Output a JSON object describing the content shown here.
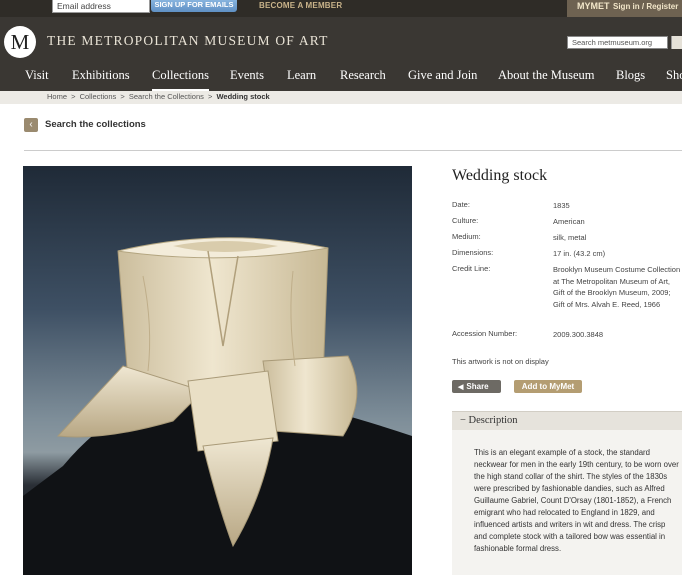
{
  "topbar": {
    "email_placeholder": "Email address",
    "signup_label": "SIGN UP FOR EMAILS",
    "become_member": "BECOME A MEMBER",
    "mymet": "MYMET",
    "signin": "Sign in / Register"
  },
  "header": {
    "logo_letter": "M",
    "title": "THE METROPOLITAN MUSEUM OF ART",
    "search_placeholder": "Search metmuseum.org",
    "nav": [
      "Visit",
      "Exhibitions",
      "Collections",
      "Events",
      "Learn",
      "Research",
      "Give and Join",
      "About the Museum",
      "Blogs",
      "Sho"
    ]
  },
  "breadcrumb": [
    "Home",
    "Collections",
    "Search the Collections",
    "Wedding stock"
  ],
  "back_link": "Search the collections",
  "object": {
    "title": "Wedding stock",
    "fields": [
      {
        "label": "Date:",
        "value": "1835"
      },
      {
        "label": "Culture:",
        "value": "American"
      },
      {
        "label": "Medium:",
        "value": "silk, metal"
      },
      {
        "label": "Dimensions:",
        "value": "17 in. (43.2 cm)"
      },
      {
        "label": "Credit Line:",
        "value": "Brooklyn Museum Costume Collection at The Metropolitan Museum of Art, Gift of the Brooklyn Museum, 2009; Gift of Mrs. Alvah E. Reed, 1966"
      },
      {
        "label": "Accession Number:",
        "value": "2009.300.3848"
      }
    ],
    "display_note": "This artwork is not on display",
    "share_label": "Share",
    "add_label": "Add to MyMet"
  },
  "description": {
    "heading": "− Description",
    "text": "This is an elegant example of a stock, the standard neckwear for men in the early 19th century, to be worn over the high stand collar of the shirt. The styles of the 1830s were prescribed by fashionable dandies, such as Alfred Guillaume Gabriel, Count D'Orsay (1801-1852), a French emigrant who had relocated to England in 1829, and influenced artists and writers in wit and dress. The crisp and complete stock with a tailored bow was essential in fashionable formal dress."
  },
  "colors": {
    "header_bg": "#3a3733",
    "accent_gold": "#b49d72",
    "signup_blue": "#6f9fd0"
  }
}
